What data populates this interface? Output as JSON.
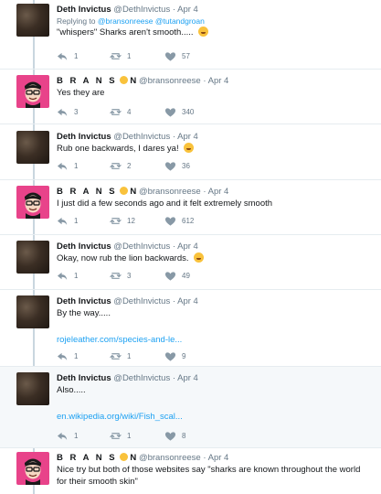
{
  "tweets": [
    {
      "name": "Deth Invictus",
      "handle": "@DethInvictus",
      "date": "· Apr 4",
      "replying_prefix": "Replying to ",
      "replying_to": "@bransonreese @tutandgroan",
      "text": "\"whispers\"  Sharks aren't smooth.....",
      "emoji": "smiling-face-emoji",
      "reply_count": "1",
      "retweet_count": "1",
      "like_count": "57"
    },
    {
      "name": "B R A N S",
      "name_suffix": "N",
      "handle": "@bransonreese",
      "date": "· Apr 4",
      "text": "Yes they are",
      "reply_count": "3",
      "retweet_count": "4",
      "like_count": "340"
    },
    {
      "name": "Deth Invictus",
      "handle": "@DethInvictus",
      "date": "· Apr 4",
      "text": "Rub one backwards, I dares ya!",
      "emoji": "rolling-laughing-emoji",
      "reply_count": "1",
      "retweet_count": "2",
      "like_count": "36"
    },
    {
      "name": "B R A N S",
      "name_suffix": "N",
      "handle": "@bransonreese",
      "date": "· Apr 4",
      "text": "I just did a few seconds ago and it felt extremely smooth",
      "reply_count": "1",
      "retweet_count": "12",
      "like_count": "612"
    },
    {
      "name": "Deth Invictus",
      "handle": "@DethInvictus",
      "date": "· Apr 4",
      "text": "Okay, now rub the lion backwards.",
      "emoji": "rolling-laughing-emoji",
      "reply_count": "1",
      "retweet_count": "3",
      "like_count": "49"
    },
    {
      "name": "Deth Invictus",
      "handle": "@DethInvictus",
      "date": "· Apr 4",
      "text": "By the way.....",
      "link": "rojeleather.com/species-and-le...",
      "reply_count": "1",
      "retweet_count": "1",
      "like_count": "9"
    },
    {
      "name": "Deth Invictus",
      "handle": "@DethInvictus",
      "date": "· Apr 4",
      "text": "Also.....",
      "link": "en.wikipedia.org/wiki/Fish_scal...",
      "reply_count": "1",
      "retweet_count": "1",
      "like_count": "8"
    },
    {
      "name": "B R A N S",
      "name_suffix": "N",
      "handle": "@bransonreese",
      "date": "· Apr 4",
      "text": "Nice try but both of those websites say \"sharks are known throughout the world for their smooth skin\""
    }
  ],
  "colors": {
    "link": "#1da1f2",
    "muted": "#657786",
    "avatar_pink": "#e8438a",
    "thread_line": "#c9d6df",
    "highlight_bg": "#f5f8fa"
  }
}
